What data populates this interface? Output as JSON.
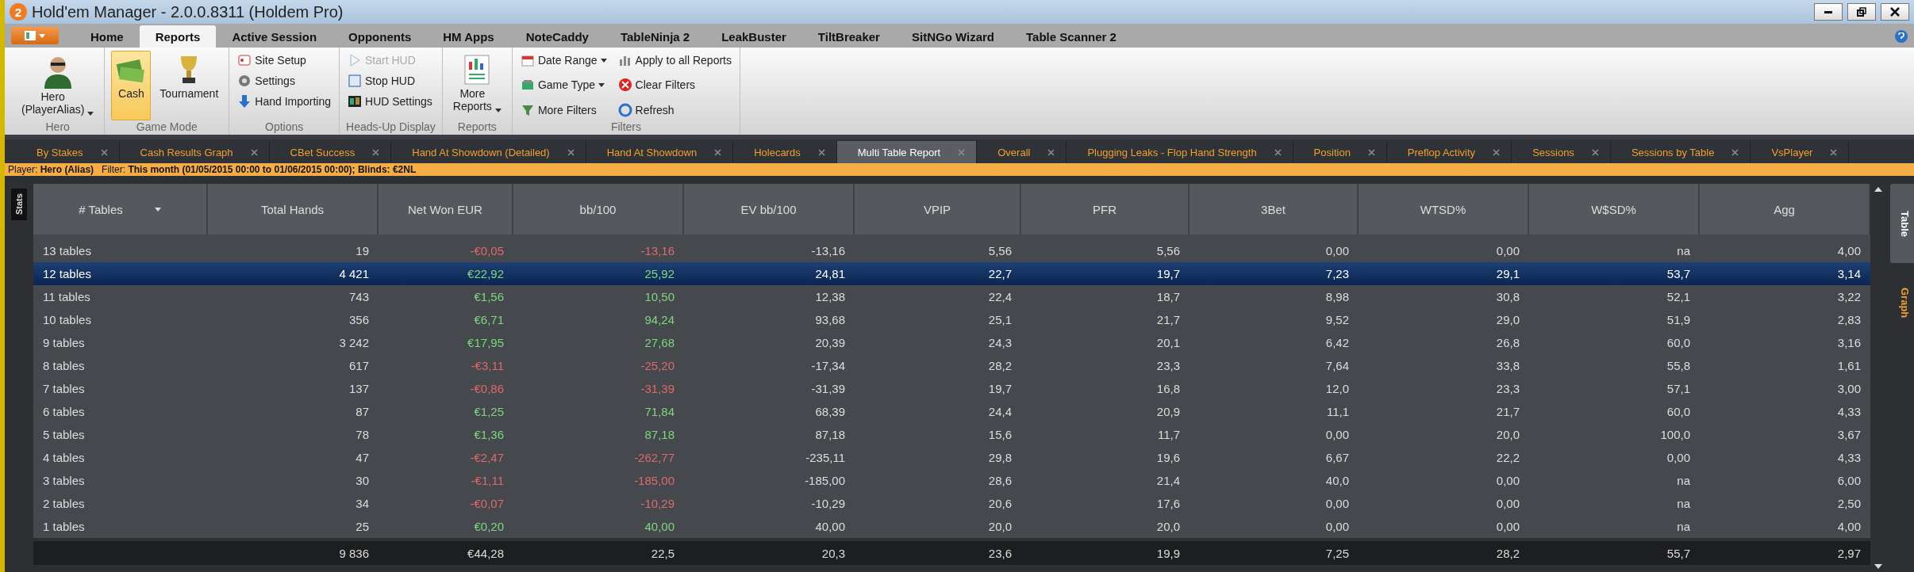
{
  "window": {
    "title": "Hold'em Manager - 2.0.0.8311 (Holdem Pro)",
    "app_badge": "2"
  },
  "menu_tabs": [
    {
      "label": "Home",
      "selected": false
    },
    {
      "label": "Reports",
      "selected": true
    },
    {
      "label": "Active Session",
      "selected": false
    },
    {
      "label": "Opponents",
      "selected": false
    },
    {
      "label": "HM Apps",
      "selected": false
    },
    {
      "label": "NoteCaddy",
      "selected": false
    },
    {
      "label": "TableNinja 2",
      "selected": false
    },
    {
      "label": "LeakBuster",
      "selected": false
    },
    {
      "label": "TiltBreaker",
      "selected": false
    },
    {
      "label": "SitNGo Wizard",
      "selected": false
    },
    {
      "label": "Table Scanner 2",
      "selected": false
    }
  ],
  "ribbon": [
    {
      "name": "Hero",
      "kind": "hero",
      "items": [
        {
          "label": "Hero\n(PlayerAlias)",
          "dropdown": true
        }
      ]
    },
    {
      "name": "Game Mode",
      "kind": "large",
      "items": [
        {
          "label": "Cash",
          "selected": true
        },
        {
          "label": "Tournament",
          "selected": false
        }
      ]
    },
    {
      "name": "Options",
      "kind": "small",
      "items": [
        {
          "label": "Site Setup",
          "disabled": false
        },
        {
          "label": "Settings",
          "disabled": false
        },
        {
          "label": "Hand Importing",
          "disabled": false
        }
      ]
    },
    {
      "name": "Heads-Up Display",
      "kind": "small",
      "items": [
        {
          "label": "Start HUD",
          "disabled": true
        },
        {
          "label": "Stop HUD",
          "disabled": false
        },
        {
          "label": "HUD Settings",
          "disabled": false
        }
      ]
    },
    {
      "name": "Reports",
      "kind": "large",
      "items": [
        {
          "label": "More\nReports",
          "selected": false,
          "dropdown": true
        }
      ]
    },
    {
      "name": "Filters",
      "kind": "small2",
      "items": [
        {
          "label": "Date Range",
          "dropdown": true
        },
        {
          "label": "Game Type",
          "dropdown": true
        },
        {
          "label": "More Filters"
        },
        {
          "label": "Apply to all Reports"
        },
        {
          "label": "Clear Filters"
        },
        {
          "label": "Refresh"
        }
      ]
    }
  ],
  "doc_tabs": [
    {
      "label": "By Stakes",
      "selected": false
    },
    {
      "label": "Cash Results Graph",
      "selected": false
    },
    {
      "label": "CBet Success",
      "selected": false
    },
    {
      "label": "Hand At Showdown (Detailed)",
      "selected": false
    },
    {
      "label": "Hand At Showdown",
      "selected": false
    },
    {
      "label": "Holecards",
      "selected": false
    },
    {
      "label": "Multi Table Report",
      "selected": true
    },
    {
      "label": "Overall",
      "selected": false
    },
    {
      "label": "Plugging Leaks - Flop Hand Strength",
      "selected": false
    },
    {
      "label": "Position",
      "selected": false
    },
    {
      "label": "Preflop Activity",
      "selected": false
    },
    {
      "label": "Sessions",
      "selected": false
    },
    {
      "label": "Sessions by Table",
      "selected": false
    },
    {
      "label": "VsPlayer",
      "selected": false
    }
  ],
  "filter_bar": [
    {
      "label": "Player:",
      "value": "Hero (Alias)"
    },
    {
      "label": "Filter:",
      "value": "This month (01/05/2015 00:00 to 01/06/2015 00:00); Blinds: €2NL"
    }
  ],
  "stats_tab": "Stats",
  "side_tabs": [
    {
      "label": "Table",
      "selected": true
    },
    {
      "label": "Graph",
      "selected": false
    }
  ],
  "table": {
    "columns": [
      "# Tables",
      "Total Hands",
      "Net Won EUR",
      "bb/100",
      "EV bb/100",
      "VPIP",
      "PFR",
      "3Bet",
      "WTSD%",
      "W$SD%",
      "Agg"
    ],
    "rows": [
      {
        "selected": false,
        "negative": true,
        "cells": [
          "13 tables",
          "19",
          "-€0,05",
          "-13,16",
          "-13,16",
          "5,56",
          "5,56",
          "0,00",
          "0,00",
          "na",
          "4,00"
        ]
      },
      {
        "selected": true,
        "negative": false,
        "cells": [
          "12 tables",
          "4 421",
          "€22,92",
          "25,92",
          "24,81",
          "22,7",
          "19,7",
          "7,23",
          "29,1",
          "53,7",
          "3,14"
        ]
      },
      {
        "selected": false,
        "negative": false,
        "cells": [
          "11 tables",
          "743",
          "€1,56",
          "10,50",
          "12,38",
          "22,4",
          "18,7",
          "8,98",
          "30,8",
          "52,1",
          "3,22"
        ]
      },
      {
        "selected": false,
        "negative": false,
        "cells": [
          "10 tables",
          "356",
          "€6,71",
          "94,24",
          "93,68",
          "25,1",
          "21,7",
          "9,52",
          "29,0",
          "51,9",
          "2,83"
        ]
      },
      {
        "selected": false,
        "negative": false,
        "cells": [
          "9 tables",
          "3 242",
          "€17,95",
          "27,68",
          "20,39",
          "24,3",
          "20,1",
          "6,42",
          "26,8",
          "60,0",
          "3,16"
        ]
      },
      {
        "selected": false,
        "negative": true,
        "cells": [
          "8 tables",
          "617",
          "-€3,11",
          "-25,20",
          "-17,34",
          "28,2",
          "23,3",
          "7,64",
          "33,8",
          "55,8",
          "1,61"
        ]
      },
      {
        "selected": false,
        "negative": true,
        "cells": [
          "7 tables",
          "137",
          "-€0,86",
          "-31,39",
          "-31,39",
          "19,7",
          "16,8",
          "12,0",
          "23,3",
          "57,1",
          "3,00"
        ]
      },
      {
        "selected": false,
        "negative": false,
        "cells": [
          "6 tables",
          "87",
          "€1,25",
          "71,84",
          "68,39",
          "24,4",
          "20,9",
          "11,1",
          "21,7",
          "60,0",
          "4,33"
        ]
      },
      {
        "selected": false,
        "negative": false,
        "cells": [
          "5 tables",
          "78",
          "€1,36",
          "87,18",
          "87,18",
          "15,6",
          "11,7",
          "0,00",
          "20,0",
          "100,0",
          "3,67"
        ]
      },
      {
        "selected": false,
        "negative": true,
        "cells": [
          "4 tables",
          "47",
          "-€2,47",
          "-262,77",
          "-235,11",
          "29,8",
          "19,6",
          "6,67",
          "22,2",
          "0,00",
          "4,33"
        ]
      },
      {
        "selected": false,
        "negative": true,
        "cells": [
          "3 tables",
          "30",
          "-€1,11",
          "-185,00",
          "-185,00",
          "28,6",
          "21,4",
          "40,0",
          "0,00",
          "na",
          "6,00"
        ]
      },
      {
        "selected": false,
        "negative": true,
        "cells": [
          "2 tables",
          "34",
          "-€0,07",
          "-10,29",
          "-10,29",
          "20,6",
          "17,6",
          "0,00",
          "0,00",
          "na",
          "2,50"
        ]
      },
      {
        "selected": false,
        "negative": false,
        "cells": [
          "1 tables",
          "25",
          "€0,20",
          "40,00",
          "40,00",
          "20,0",
          "20,0",
          "0,00",
          "0,00",
          "na",
          "4,00"
        ]
      }
    ],
    "totals": [
      "9 836",
      "€44,28",
      "22,5",
      "20,3",
      "23,6",
      "19,9",
      "7,25",
      "28,2",
      "55,7",
      "2,97"
    ]
  }
}
